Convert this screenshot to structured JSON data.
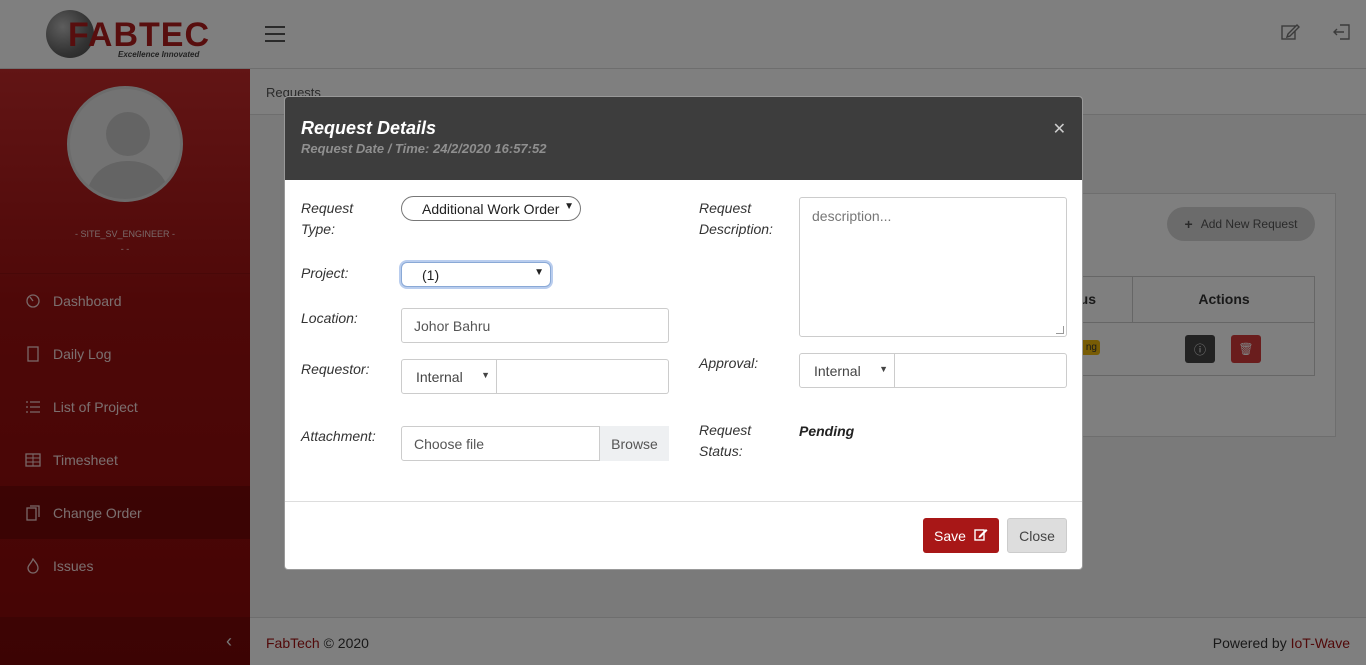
{
  "brand": {
    "logo_text": "FABTEC",
    "tagline": "Excellence Innovated"
  },
  "header": {
    "menu_icon": "hamburger-icon",
    "edit_icon": "edit-icon",
    "logout_icon": "logout-icon"
  },
  "sidebar": {
    "user_role": "- SITE_SV_ENGINEER -",
    "user_sub": "- -",
    "items": [
      {
        "label": "Dashboard",
        "icon": "dashboard-icon"
      },
      {
        "label": "Daily Log",
        "icon": "daily-log-icon"
      },
      {
        "label": "List of Project",
        "icon": "list-icon"
      },
      {
        "label": "Timesheet",
        "icon": "timesheet-icon"
      },
      {
        "label": "Change Order",
        "icon": "change-order-icon",
        "active": true
      },
      {
        "label": "Issues",
        "icon": "issues-icon"
      }
    ],
    "collapse_icon": "chevron-left-icon"
  },
  "page": {
    "breadcrumb": "Requests",
    "add_button": "Add New Request",
    "table": {
      "status_header": "us",
      "actions_header": "Actions",
      "status_badge": "ng"
    }
  },
  "footer": {
    "brand": "FabTech",
    "copyright": "© 2020",
    "powered_by": "Powered by",
    "powered_link": "IoT-Wave"
  },
  "modal": {
    "title": "Request Details",
    "subtitle": "Request Date / Time: 24/2/2020 16:57:52",
    "close_icon": "close-icon",
    "fields": {
      "request_type_label_1": "Request",
      "request_type_label_2": "Type:",
      "request_type_value": "Additional Work Order",
      "project_label": "Project:",
      "project_value": "(1)",
      "location_label": "Location:",
      "location_value": "Johor Bahru",
      "requestor_label": "Requestor:",
      "requestor_type": "Internal",
      "requestor_value": "",
      "attachment_label": "Attachment:",
      "attachment_placeholder": "Choose file",
      "attachment_browse": "Browse",
      "description_label_1": "Request",
      "description_label_2": "Description:",
      "description_placeholder": "description...",
      "approval_label": "Approval:",
      "approval_type": "Internal",
      "approval_value": "",
      "status_label_1": "Request",
      "status_label_2": "Status:",
      "status_value": "Pending"
    },
    "buttons": {
      "save": "Save",
      "close": "Close"
    }
  }
}
